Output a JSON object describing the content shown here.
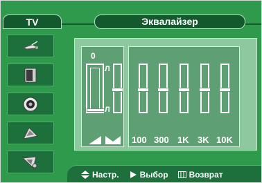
{
  "header": {
    "tab_label": "TV",
    "title": "Эквалайзер"
  },
  "sidebar": {
    "items": [
      {
        "icon": "antenna-icon"
      },
      {
        "icon": "screen-icon"
      },
      {
        "icon": "speaker-icon"
      },
      {
        "icon": "satellite-dish-icon"
      },
      {
        "icon": "settings-dish-icon"
      }
    ]
  },
  "equalizer": {
    "balance": {
      "value_label": "0",
      "left_top_label": "Л",
      "left_bottom_label": "Л",
      "level": 0.05
    },
    "bands": [
      {
        "label": "100",
        "level": 0.5
      },
      {
        "label": "300",
        "level": 0.5
      },
      {
        "label": "1K",
        "level": 0.5
      },
      {
        "label": "3K",
        "level": 0.5
      },
      {
        "label": "10K",
        "level": 0.5
      }
    ],
    "first_slider_level": 0.5
  },
  "footer": {
    "hints": [
      {
        "icon": "up-down-arrow-icon",
        "label": "Настр."
      },
      {
        "icon": "right-arrow-icon",
        "label": "Выбор"
      },
      {
        "icon": "menu-icon",
        "label": "Возврат"
      }
    ]
  },
  "colors": {
    "background": "#2f9a4c",
    "dark_green": "#13592d",
    "panel": "#8ec89f",
    "band": "#5f9f74",
    "text": "#ffffff"
  }
}
